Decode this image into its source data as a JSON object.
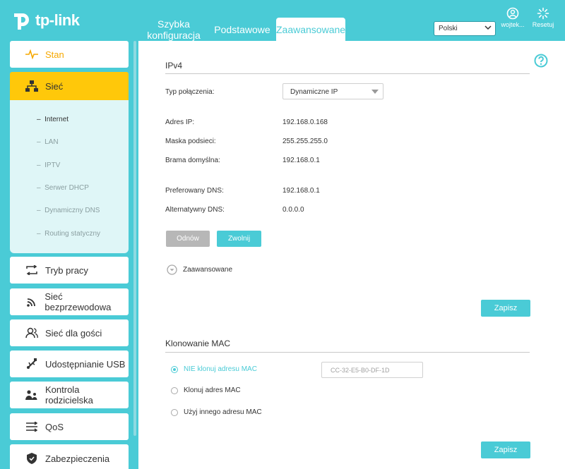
{
  "brand": {
    "name": "tp-link"
  },
  "tabs": {
    "quick": "Szybka konfiguracja",
    "basic": "Podstawowe",
    "advanced": "Zaawansowane"
  },
  "header": {
    "language": "Polski",
    "user_label": "wojtek...",
    "reset_label": "Resetuj"
  },
  "sidebar": {
    "status": "Stan",
    "network": "Sieć",
    "network_sub": [
      "Internet",
      "LAN",
      "IPTV",
      "Serwer DHCP",
      "Dynamiczny DNS",
      "Routing statyczny"
    ],
    "mode": "Tryb pracy",
    "wireless": "Sieć bezprzewodowa",
    "guest": "Sieć dla gości",
    "usb": "Udostępnianie USB",
    "parental": "Kontrola rodzicielska",
    "qos": "QoS",
    "security": "Zabezpieczenia"
  },
  "ipv4": {
    "title": "IPv4",
    "conn_type_label": "Typ połączenia:",
    "conn_type_value": "Dynamiczne IP",
    "ip_label": "Adres IP:",
    "ip_value": "192.168.0.168",
    "mask_label": "Maska podsieci:",
    "mask_value": "255.255.255.0",
    "gateway_label": "Brama domyślna:",
    "gateway_value": "192.168.0.1",
    "dns1_label": "Preferowany DNS:",
    "dns1_value": "192.168.0.1",
    "dns2_label": "Alternatywny DNS:",
    "dns2_value": "0.0.0.0",
    "renew": "Odnów",
    "release": "Zwolnij",
    "advanced": "Zaawansowane",
    "save": "Zapisz"
  },
  "mac_clone": {
    "title": "Klonowanie MAC",
    "options": [
      "NIE klonuj adresu MAC",
      "Klonuj adres MAC",
      "Użyj innego adresu MAC"
    ],
    "mac_placeholder": "CC-32-E5-B0-DF-1D",
    "save": "Zapisz"
  },
  "colors": {
    "accent": "#4acbd6",
    "active_nav": "#ffc80a",
    "status_orange": "#f6a800",
    "submenu_bg": "#dff6f7"
  }
}
